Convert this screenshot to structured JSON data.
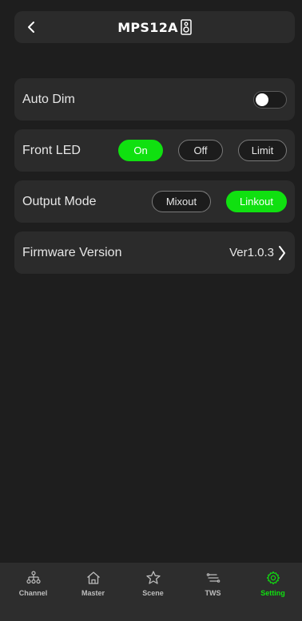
{
  "header": {
    "title": "MPS12A",
    "back_icon": "chevron-left-icon",
    "device_icon": "speaker-icon"
  },
  "settings": {
    "auto_dim": {
      "label": "Auto Dim",
      "enabled": false
    },
    "front_led": {
      "label": "Front LED",
      "options": [
        "On",
        "Off",
        "Limit"
      ],
      "selected": "On"
    },
    "output_mode": {
      "label": "Output Mode",
      "options": [
        "Mixout",
        "Linkout"
      ],
      "selected": "Linkout"
    },
    "firmware": {
      "label": "Firmware Version",
      "value": "Ver1.0.3",
      "icon": "chevron-right-icon"
    }
  },
  "tabbar": {
    "items": [
      {
        "label": "Channel",
        "icon": "channel-tree-icon"
      },
      {
        "label": "Master",
        "icon": "home-icon"
      },
      {
        "label": "Scene",
        "icon": "star-icon"
      },
      {
        "label": "TWS",
        "icon": "tws-link-icon"
      },
      {
        "label": "Setting",
        "icon": "gear-icon"
      }
    ],
    "active": "Setting"
  },
  "colors": {
    "accent": "#10e010",
    "background": "#1e1e1e",
    "card": "#2b2b2b",
    "tabbar": "#2d2d2d"
  }
}
